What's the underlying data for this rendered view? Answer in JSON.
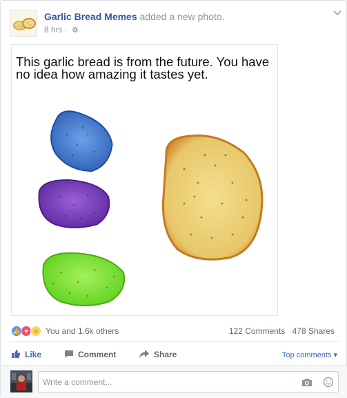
{
  "post": {
    "page_name": "Garlic Bread Memes",
    "action_text": " added a new photo.",
    "timestamp": "8 hrs",
    "separator": "·",
    "privacy_icon": "gear-globe-icon",
    "menu_icon": "chevron-down-icon"
  },
  "photo": {
    "caption": "This garlic bread is from the future. You have no idea how amazing it tastes yet.",
    "breads": [
      "blue",
      "purple",
      "green",
      "golden"
    ],
    "colors": {
      "blue": "#4a7fd0",
      "purple": "#7a3fbf",
      "green": "#7ee63a",
      "golden": "#e8c060"
    }
  },
  "stats": {
    "reactions": [
      "like-icon",
      "love-icon",
      "haha-icon"
    ],
    "reactions_text": "You and 1.6k others",
    "comments": "122 Comments",
    "shares": "478 Shares"
  },
  "actions": {
    "like": "Like",
    "comment": "Comment",
    "share": "Share",
    "top_comments": "Top comments ▾"
  },
  "composer": {
    "placeholder": "Write a comment..."
  },
  "colors": {
    "link": "#365899",
    "accent": "#4267b2",
    "muted": "#90949c"
  }
}
